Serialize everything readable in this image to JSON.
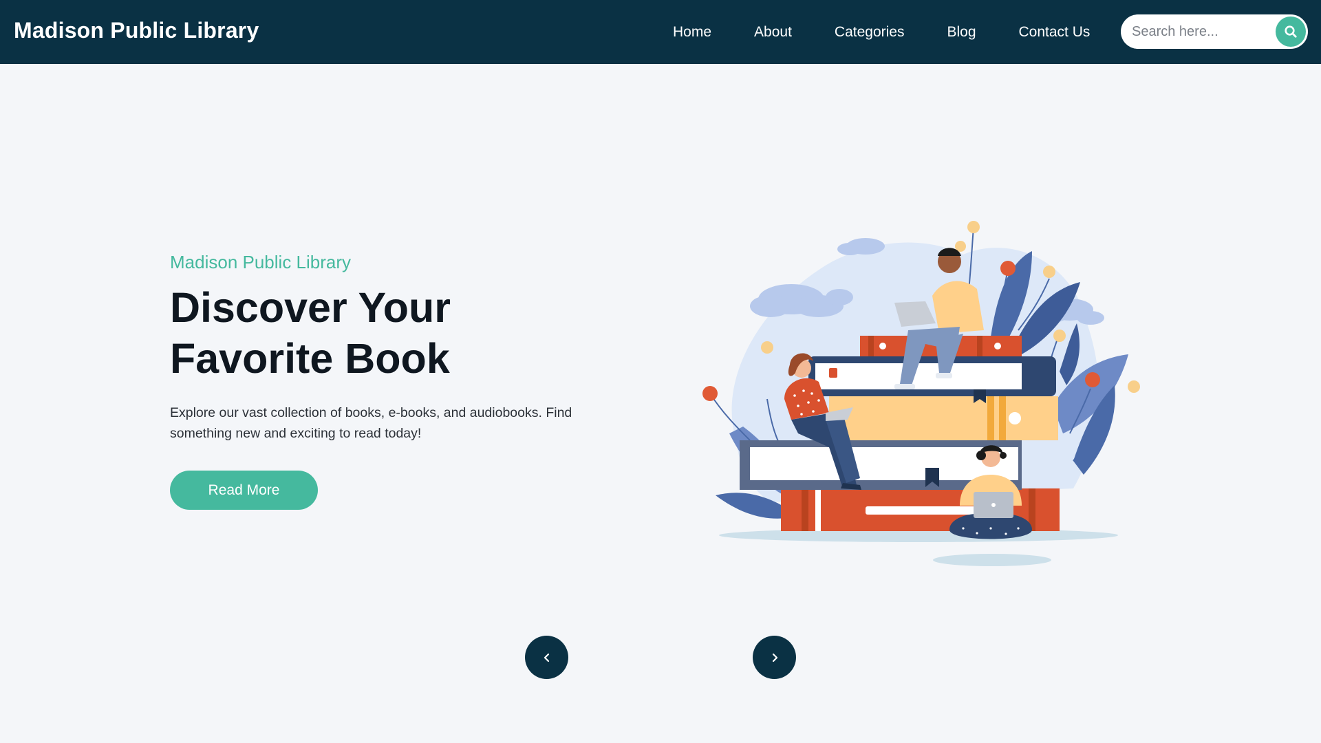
{
  "navbar": {
    "brand": "Madison Public Library",
    "links": [
      {
        "label": "Home"
      },
      {
        "label": "About"
      },
      {
        "label": "Categories"
      },
      {
        "label": "Blog"
      },
      {
        "label": "Contact Us"
      }
    ],
    "search": {
      "placeholder": "Search here...",
      "value": "",
      "icon": "search-icon"
    }
  },
  "hero": {
    "eyebrow": "Madison Public Library",
    "title_line1": "Discover Your",
    "title_line2": "Favorite Book",
    "description": "Explore our vast collection of books, e-books, and audiobooks. Find something new and exciting to read today!",
    "cta_label": "Read More",
    "illustration": "people-reading-on-book-stack-illustration"
  },
  "carousel": {
    "prev_icon": "chevron-left-icon",
    "next_icon": "chevron-right-icon"
  },
  "colors": {
    "navbar_bg": "#0a3144",
    "accent": "#45b99e",
    "page_bg": "#f4f6f9",
    "heading": "#0f1720"
  }
}
